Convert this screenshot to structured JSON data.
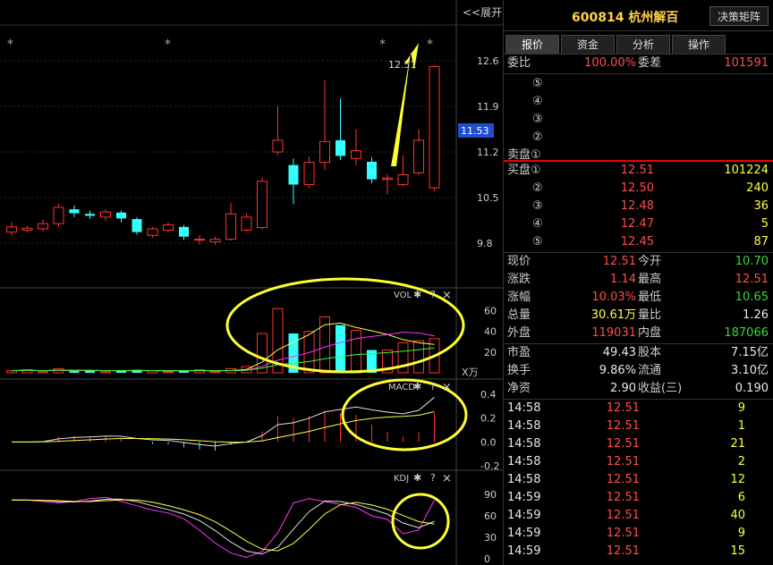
{
  "chart": {
    "expand_label": "<<展开",
    "star": "*",
    "price_annotation": "12.51",
    "price_axis": [
      "12.6",
      "11.9",
      "11.53",
      "11.2",
      "10.5",
      "9.8"
    ],
    "vol_title": "VOL",
    "vol_axis": [
      "60",
      "40",
      "20"
    ],
    "vol_unit": "X万",
    "macd_title": "MACD",
    "macd_axis": [
      "0.4",
      "0.2",
      "0.0",
      "-0.2"
    ],
    "kdj_title": "KDJ",
    "kdj_axis": [
      "90",
      "60",
      "30",
      "0"
    ],
    "gear_glyph": "✱",
    "help_glyph": "?",
    "close_glyph": "×",
    "colors": {
      "up": "#ff3333",
      "down": "#33ffff",
      "annotate": "#ffff33",
      "ma_white": "#e0e0e0",
      "ma_yellow": "#ffff44",
      "ma_magenta": "#ff33ff",
      "ma_green": "#33ff33",
      "current_price_box": "#1f4fd0"
    }
  },
  "header": {
    "stock_code": "600814 杭州解百",
    "strategy_button": "决策矩阵"
  },
  "tabs": [
    "报价",
    "资金",
    "分析",
    "操作"
  ],
  "order_ratio": {
    "label": "委比",
    "value": "100.00%",
    "label2": "委差",
    "value2": "101591"
  },
  "sell_levels": [
    "⑤",
    "④",
    "③",
    "②",
    "卖盘①"
  ],
  "buy_levels": [
    {
      "label": "买盘①",
      "price": "12.51",
      "vol": "101224"
    },
    {
      "label": "②",
      "price": "12.50",
      "vol": "240"
    },
    {
      "label": "③",
      "price": "12.48",
      "vol": "36"
    },
    {
      "label": "④",
      "price": "12.47",
      "vol": "5"
    },
    {
      "label": "⑤",
      "price": "12.45",
      "vol": "87"
    }
  ],
  "quote_rows": [
    {
      "l1": "现价",
      "v1": "12.51",
      "c1": "red",
      "l2": "今开",
      "v2": "10.70",
      "c2": "green"
    },
    {
      "l1": "涨跌",
      "v1": "1.14",
      "c1": "red",
      "l2": "最高",
      "v2": "12.51",
      "c2": "red"
    },
    {
      "l1": "涨幅",
      "v1": "10.03%",
      "c1": "red",
      "l2": "最低",
      "v2": "10.65",
      "c2": "green"
    },
    {
      "l1": "总量",
      "v1": "30.61万",
      "c1": "yellow",
      "l2": "量比",
      "v2": "1.26",
      "c2": "white"
    },
    {
      "l1": "外盘",
      "v1": "119031",
      "c1": "red",
      "l2": "内盘",
      "v2": "187066",
      "c2": "green"
    }
  ],
  "fin_rows": [
    {
      "l1": "市盈",
      "v1": "49.43",
      "l2": "股本",
      "v2": "7.15亿"
    },
    {
      "l1": "换手",
      "v1": "9.86%",
      "l2": "流通",
      "v2": "3.10亿"
    },
    {
      "l1": "净资",
      "v1": "2.90",
      "l2": "收益(三)",
      "v2": "0.190"
    }
  ],
  "ticks": [
    {
      "time": "14:58",
      "price": "12.51",
      "vol": "9"
    },
    {
      "time": "14:58",
      "price": "12.51",
      "vol": "1"
    },
    {
      "time": "14:58",
      "price": "12.51",
      "vol": "21"
    },
    {
      "time": "14:58",
      "price": "12.51",
      "vol": "2"
    },
    {
      "time": "14:58",
      "price": "12.51",
      "vol": "12"
    },
    {
      "time": "14:59",
      "price": "12.51",
      "vol": "6"
    },
    {
      "time": "14:59",
      "price": "12.51",
      "vol": "40"
    },
    {
      "time": "14:59",
      "price": "12.51",
      "vol": "9"
    },
    {
      "time": "14:59",
      "price": "12.51",
      "vol": "15"
    }
  ],
  "chart_data": {
    "type": "candlestick",
    "candles": [
      {
        "o": 9.97,
        "c": 10.05,
        "h": 10.12,
        "l": 9.92
      },
      {
        "o": 10.0,
        "c": 10.03,
        "h": 10.06,
        "l": 9.97
      },
      {
        "o": 10.02,
        "c": 10.1,
        "h": 10.16,
        "l": 9.98
      },
      {
        "o": 10.1,
        "c": 10.35,
        "h": 10.4,
        "l": 10.05
      },
      {
        "o": 10.32,
        "c": 10.26,
        "h": 10.38,
        "l": 10.2
      },
      {
        "o": 10.25,
        "c": 10.22,
        "h": 10.3,
        "l": 10.17
      },
      {
        "o": 10.2,
        "c": 10.28,
        "h": 10.32,
        "l": 10.15
      },
      {
        "o": 10.27,
        "c": 10.18,
        "h": 10.3,
        "l": 10.12
      },
      {
        "o": 10.17,
        "c": 9.97,
        "h": 10.2,
        "l": 9.93
      },
      {
        "o": 9.92,
        "c": 10.02,
        "h": 10.05,
        "l": 9.88
      },
      {
        "o": 10.0,
        "c": 10.08,
        "h": 10.12,
        "l": 9.97
      },
      {
        "o": 10.05,
        "c": 9.9,
        "h": 10.08,
        "l": 9.85
      },
      {
        "o": 9.85,
        "c": 9.86,
        "h": 9.92,
        "l": 9.78
      },
      {
        "o": 9.82,
        "c": 9.86,
        "h": 9.9,
        "l": 9.78
      },
      {
        "o": 9.86,
        "c": 10.25,
        "h": 10.42,
        "l": 9.84
      },
      {
        "o": 10.0,
        "c": 10.2,
        "h": 10.25,
        "l": 9.98
      },
      {
        "o": 10.04,
        "c": 10.75,
        "h": 10.8,
        "l": 10.01
      },
      {
        "o": 11.2,
        "c": 11.38,
        "h": 11.9,
        "l": 11.15
      },
      {
        "o": 11.0,
        "c": 10.7,
        "h": 11.1,
        "l": 10.4
      },
      {
        "o": 10.7,
        "c": 11.04,
        "h": 11.13,
        "l": 10.65
      },
      {
        "o": 11.04,
        "c": 11.36,
        "h": 12.3,
        "l": 10.92
      },
      {
        "o": 11.38,
        "c": 11.14,
        "h": 12.02,
        "l": 11.08
      },
      {
        "o": 11.1,
        "c": 11.22,
        "h": 11.55,
        "l": 11.0
      },
      {
        "o": 11.05,
        "c": 10.78,
        "h": 11.12,
        "l": 10.72
      },
      {
        "o": 10.78,
        "c": 10.8,
        "h": 10.86,
        "l": 10.55
      },
      {
        "o": 10.7,
        "c": 10.85,
        "h": 11.15,
        "l": 10.67
      },
      {
        "o": 10.88,
        "c": 11.38,
        "h": 11.55,
        "l": 10.85
      },
      {
        "o": 10.65,
        "c": 12.51,
        "h": 12.51,
        "l": 10.6
      }
    ],
    "volume": [
      2,
      3,
      1,
      4,
      2,
      2,
      1,
      2,
      3,
      2,
      1,
      2,
      3,
      1,
      4,
      6,
      38,
      62,
      38,
      40,
      54,
      46,
      41,
      22,
      22,
      29,
      31,
      33
    ],
    "kdj_j": [
      82,
      82,
      80,
      78,
      80,
      84,
      86,
      80,
      74,
      68,
      64,
      56,
      40,
      22,
      8,
      2,
      10,
      36,
      78,
      84,
      80,
      76,
      72,
      60,
      55,
      35,
      40,
      82
    ]
  }
}
